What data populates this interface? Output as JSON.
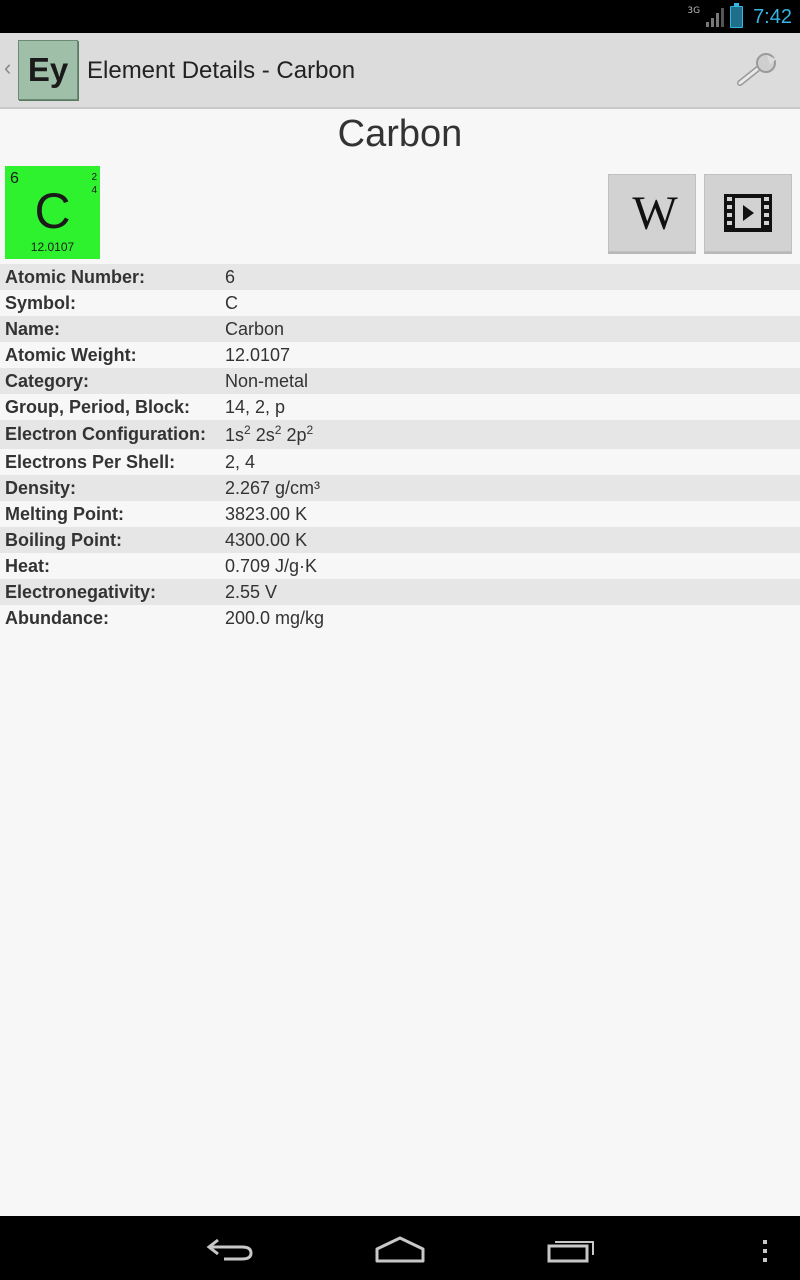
{
  "status_bar": {
    "network": "3G",
    "time": "7:42"
  },
  "action_bar": {
    "app_icon_text": "Ey",
    "title": "Element Details - Carbon"
  },
  "element": {
    "title": "Carbon",
    "tile": {
      "number": "6",
      "shells_top": "2",
      "shells_bottom": "4",
      "symbol": "C",
      "weight": "12.0107",
      "color": "#2ff22f"
    }
  },
  "buttons": {
    "wiki_glyph": "W"
  },
  "details": [
    {
      "label": "Atomic Number:",
      "value": "6"
    },
    {
      "label": "Symbol:",
      "value": "C"
    },
    {
      "label": "Name:",
      "value": "Carbon"
    },
    {
      "label": "Atomic Weight:",
      "value": "12.0107"
    },
    {
      "label": "Category:",
      "value": "Non-metal"
    },
    {
      "label": "Group, Period, Block:",
      "value": "14, 2, p"
    },
    {
      "label": "Electron Configuration:",
      "config": [
        {
          "base": "1s",
          "sup": "2"
        },
        {
          "base": "2s",
          "sup": "2"
        },
        {
          "base": "2p",
          "sup": "2"
        }
      ]
    },
    {
      "label": "Electrons Per Shell:",
      "value": "2, 4"
    },
    {
      "label": "Density:",
      "value": "2.267 g/cm³"
    },
    {
      "label": "Melting Point:",
      "value": "3823.00 K"
    },
    {
      "label": "Boiling Point:",
      "value": "4300.00 K"
    },
    {
      "label": "Heat:",
      "value": "0.709 J/g·K"
    },
    {
      "label": "Electronegativity:",
      "value": "2.55 V"
    },
    {
      "label": "Abundance:",
      "value": "200.0 mg/kg"
    }
  ]
}
